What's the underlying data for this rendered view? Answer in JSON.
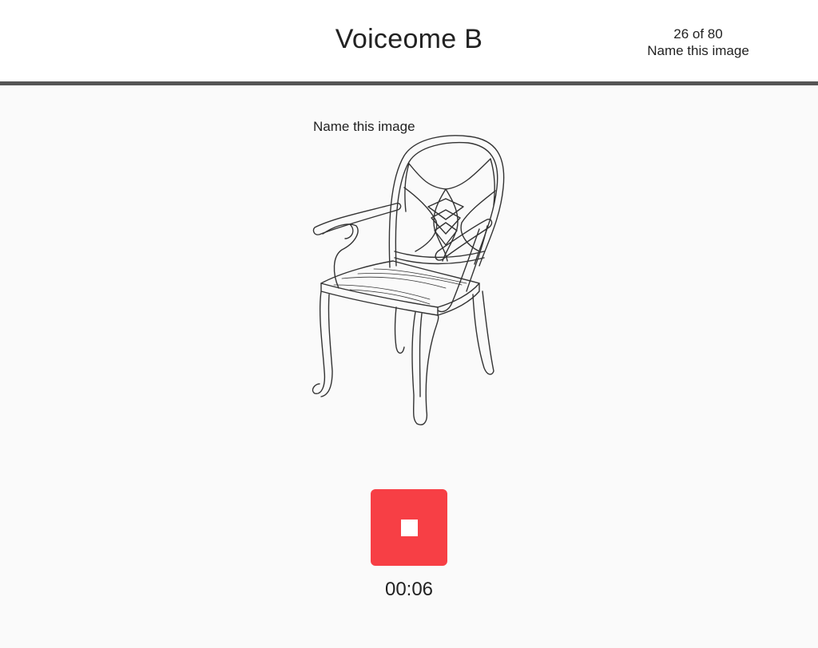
{
  "header": {
    "title": "Voiceome B",
    "progress": "26 of 80",
    "task_name": "Name this image"
  },
  "task": {
    "prompt": "Name this image",
    "image_subject": "chair",
    "record_button_icon": "stop-icon",
    "record_button_color": "#f73f45",
    "timer": "00:06"
  }
}
